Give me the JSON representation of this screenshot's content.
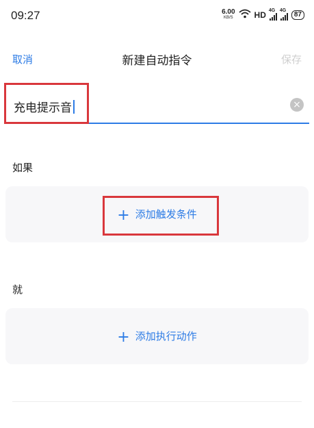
{
  "status_bar": {
    "time": "09:27",
    "net_speed_value": "6.00",
    "net_speed_unit": "KB/S",
    "wifi_icon": "wifi-icon",
    "hd_label": "HD",
    "signal_1_tag": "4G",
    "signal_2_tag": "4G",
    "battery": "87"
  },
  "nav": {
    "cancel_label": "取消",
    "title": "新建自动指令",
    "save_label": "保存"
  },
  "command_name": {
    "value": "充电提示音",
    "clear_icon": "clear-icon"
  },
  "if_section": {
    "label": "如果",
    "add_condition_label": "添加触发条件"
  },
  "then_section": {
    "label": "就",
    "add_action_label": "添加执行动作"
  },
  "colors": {
    "accent": "#2c7be5",
    "highlight": "#d9373c",
    "card_bg": "#f7f7f9"
  }
}
